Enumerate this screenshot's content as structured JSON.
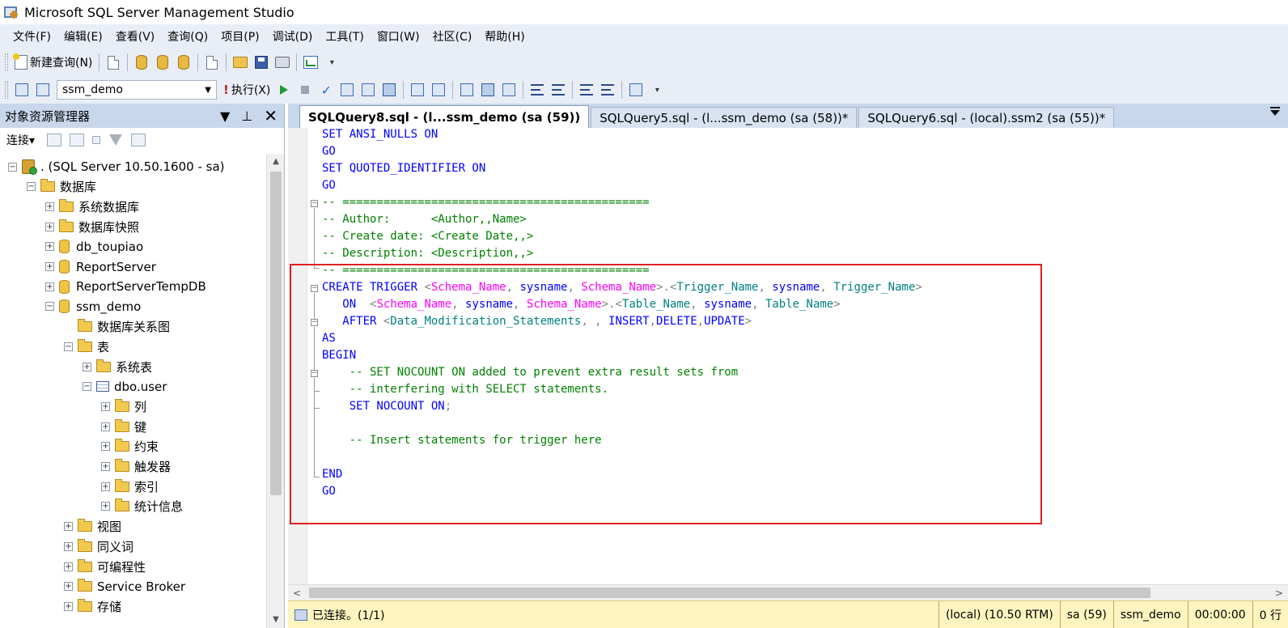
{
  "window": {
    "title": "Microsoft SQL Server Management Studio"
  },
  "menu": [
    "文件(F)",
    "编辑(E)",
    "查看(V)",
    "查询(Q)",
    "项目(P)",
    "调试(D)",
    "工具(T)",
    "窗口(W)",
    "社区(C)",
    "帮助(H)"
  ],
  "toolbar1": {
    "new_query_label": "新建查询(N)"
  },
  "toolbar2": {
    "database_selected": "ssm_demo",
    "execute_label": "执行(X)"
  },
  "object_explorer": {
    "title": "对象资源管理器",
    "connect_label": "连接",
    "tree": [
      {
        "label": ". (SQL Server 10.50.1600 - sa)",
        "level": 0,
        "expander": "-",
        "icon": "server-icon"
      },
      {
        "label": "数据库",
        "level": 1,
        "expander": "-",
        "icon": "folder-icon"
      },
      {
        "label": "系统数据库",
        "level": 2,
        "expander": "+",
        "icon": "folder-icon"
      },
      {
        "label": "数据库快照",
        "level": 2,
        "expander": "+",
        "icon": "folder-icon"
      },
      {
        "label": "db_toupiao",
        "level": 2,
        "expander": "+",
        "icon": "database-icon"
      },
      {
        "label": "ReportServer",
        "level": 2,
        "expander": "+",
        "icon": "database-icon"
      },
      {
        "label": "ReportServerTempDB",
        "level": 2,
        "expander": "+",
        "icon": "database-icon"
      },
      {
        "label": "ssm_demo",
        "level": 2,
        "expander": "-",
        "icon": "database-icon"
      },
      {
        "label": "数据库关系图",
        "level": 3,
        "expander": "",
        "icon": "folder-icon"
      },
      {
        "label": "表",
        "level": 3,
        "expander": "-",
        "icon": "folder-icon"
      },
      {
        "label": "系统表",
        "level": 4,
        "expander": "+",
        "icon": "folder-icon"
      },
      {
        "label": "dbo.user",
        "level": 4,
        "expander": "-",
        "icon": "table-icon"
      },
      {
        "label": "列",
        "level": 5,
        "expander": "+",
        "icon": "folder-icon"
      },
      {
        "label": "键",
        "level": 5,
        "expander": "+",
        "icon": "folder-icon"
      },
      {
        "label": "约束",
        "level": 5,
        "expander": "+",
        "icon": "folder-icon"
      },
      {
        "label": "触发器",
        "level": 5,
        "expander": "+",
        "icon": "folder-icon"
      },
      {
        "label": "索引",
        "level": 5,
        "expander": "+",
        "icon": "folder-icon"
      },
      {
        "label": "统计信息",
        "level": 5,
        "expander": "+",
        "icon": "folder-icon"
      },
      {
        "label": "视图",
        "level": 3,
        "expander": "+",
        "icon": "folder-icon"
      },
      {
        "label": "同义词",
        "level": 3,
        "expander": "+",
        "icon": "folder-icon"
      },
      {
        "label": "可编程性",
        "level": 3,
        "expander": "+",
        "icon": "folder-icon"
      },
      {
        "label": "Service Broker",
        "level": 3,
        "expander": "+",
        "icon": "folder-icon"
      },
      {
        "label": "存储",
        "level": 3,
        "expander": "+",
        "icon": "folder-icon"
      }
    ]
  },
  "tabs": [
    {
      "label": "SQLQuery8.sql - (l...ssm_demo (sa (59))",
      "active": true
    },
    {
      "label": "SQLQuery5.sql - (l...ssm_demo (sa (58))*",
      "active": false
    },
    {
      "label": "SQLQuery6.sql - (local).ssm2 (sa (55))*",
      "active": false
    }
  ],
  "code_lines": [
    [
      [
        "kw",
        "SET ANSI_NULLS ON"
      ]
    ],
    [
      [
        "kw",
        "GO"
      ]
    ],
    [
      [
        "kw",
        "SET QUOTED_IDENTIFIER ON"
      ]
    ],
    [
      [
        "kw",
        "GO"
      ]
    ],
    [
      [
        "cm",
        "-- ============================================="
      ]
    ],
    [
      [
        "cm",
        "-- Author:      <Author,,Name>"
      ]
    ],
    [
      [
        "cm",
        "-- Create date: <Create Date,,>"
      ]
    ],
    [
      [
        "cm",
        "-- Description: <Description,,>"
      ]
    ],
    [
      [
        "cm",
        "-- ============================================="
      ]
    ],
    [
      [
        "kw",
        "CREATE TRIGGER "
      ],
      [
        "gr",
        "<"
      ],
      [
        "pk",
        "Schema_Name"
      ],
      [
        "gr",
        ", "
      ],
      [
        "kw",
        "sysname"
      ],
      [
        "gr",
        ", "
      ],
      [
        "pk",
        "Schema_Name"
      ],
      [
        "gr",
        ">.<"
      ],
      [
        "tl",
        "Trigger_Name"
      ],
      [
        "gr",
        ", "
      ],
      [
        "kw",
        "sysname"
      ],
      [
        "gr",
        ", "
      ],
      [
        "tl",
        "Trigger_Name"
      ],
      [
        "gr",
        ">"
      ]
    ],
    [
      [
        "kw",
        "   ON  "
      ],
      [
        "gr",
        "<"
      ],
      [
        "pk",
        "Schema_Name"
      ],
      [
        "gr",
        ", "
      ],
      [
        "kw",
        "sysname"
      ],
      [
        "gr",
        ", "
      ],
      [
        "pk",
        "Schema_Name"
      ],
      [
        "gr",
        ">.<"
      ],
      [
        "tl",
        "Table_Name"
      ],
      [
        "gr",
        ", "
      ],
      [
        "kw",
        "sysname"
      ],
      [
        "gr",
        ", "
      ],
      [
        "tl",
        "Table_Name"
      ],
      [
        "gr",
        ">"
      ]
    ],
    [
      [
        "kw",
        "   AFTER "
      ],
      [
        "gr",
        "<"
      ],
      [
        "tl",
        "Data_Modification_Statements"
      ],
      [
        "gr",
        ", , "
      ],
      [
        "kw",
        "INSERT"
      ],
      [
        "gr",
        ","
      ],
      [
        "kw",
        "DELETE"
      ],
      [
        "gr",
        ","
      ],
      [
        "kw",
        "UPDATE"
      ],
      [
        "gr",
        ">"
      ]
    ],
    [
      [
        "kw",
        "AS"
      ]
    ],
    [
      [
        "kw",
        "BEGIN"
      ]
    ],
    [
      [
        "cm",
        "    -- SET NOCOUNT ON added to prevent extra result sets from"
      ]
    ],
    [
      [
        "cm",
        "    -- interfering with SELECT statements."
      ]
    ],
    [
      [
        "kw",
        "    SET NOCOUNT ON"
      ],
      [
        "gr",
        ";"
      ]
    ],
    [],
    [
      [
        "cm",
        "    -- Insert statements for trigger here"
      ]
    ],
    [],
    [
      [
        "kw",
        "END"
      ]
    ],
    [
      [
        "kw",
        "GO"
      ]
    ]
  ],
  "status": {
    "connection": "已连接。(1/1)",
    "fields": [
      "(local) (10.50 RTM)",
      "sa (59)",
      "ssm_demo",
      "00:00:00",
      "0 行"
    ]
  }
}
